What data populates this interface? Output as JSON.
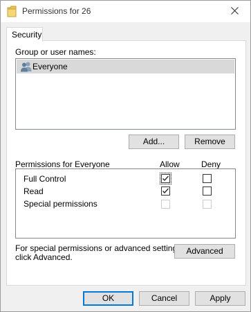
{
  "window": {
    "title": "Permissions for 26"
  },
  "tabs": [
    {
      "label": "Security",
      "selected": true
    }
  ],
  "group_section": {
    "label": "Group or user names:",
    "items": [
      {
        "name": "Everyone",
        "icon": "users-icon",
        "selected": true
      }
    ]
  },
  "group_buttons": {
    "add_label": "Add...",
    "remove_label": "Remove"
  },
  "permissions": {
    "header_label": "Permissions for Everyone",
    "allow_label": "Allow",
    "deny_label": "Deny",
    "rows": [
      {
        "label": "Full Control",
        "allow": true,
        "deny": false,
        "enabled": true
      },
      {
        "label": "Read",
        "allow": true,
        "deny": false,
        "enabled": true
      },
      {
        "label": "Special permissions",
        "allow": false,
        "deny": false,
        "enabled": false
      }
    ]
  },
  "advanced": {
    "text_line1": "For special permissions or advanced settings,",
    "text_line2": "click Advanced.",
    "button_label": "Advanced"
  },
  "footer": {
    "ok_label": "OK",
    "cancel_label": "Cancel",
    "apply_label": "Apply"
  },
  "colors": {
    "selected_row": "#d9d9d9",
    "default_button_border": "#0078d7",
    "button_face": "#e1e1e1"
  }
}
